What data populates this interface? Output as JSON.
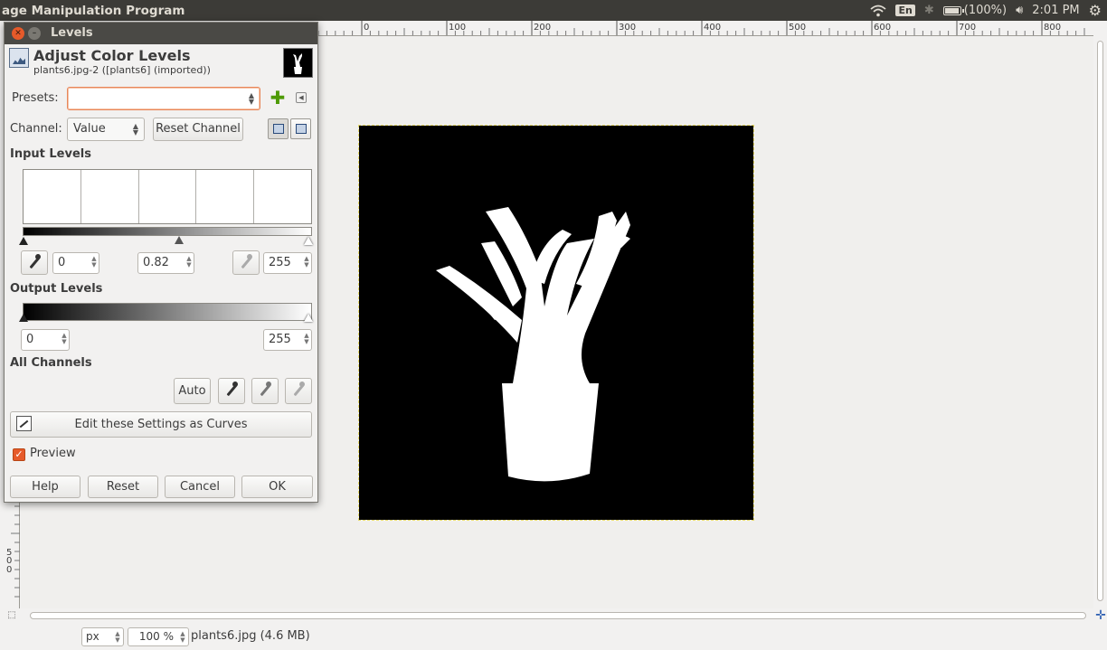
{
  "app": {
    "title": "age Manipulation Program"
  },
  "tray": {
    "keyboard": "En",
    "battery": "(100%)",
    "battery_level": 1.0,
    "time": "2:01 PM"
  },
  "ruler": {
    "h_labels": [
      "0",
      "100",
      "200",
      "300",
      "400",
      "500",
      "600",
      "700",
      "800"
    ],
    "v_labels": [
      "5",
      "0",
      "0"
    ]
  },
  "status": {
    "unit": "px",
    "zoom": "100 %",
    "file": "plants6.jpg (4.6 MB)"
  },
  "dialog": {
    "title": "Levels",
    "heading": "Adjust Color Levels",
    "subheading": "plants6.jpg-2 ([plants6] (imported))",
    "presets_label": "Presets:",
    "presets_value": "",
    "channel_label": "Channel:",
    "channel_value": "Value",
    "reset_channel": "Reset Channel",
    "input_levels": "Input Levels",
    "input_low": "0",
    "input_gamma": "0.82",
    "input_high": "255",
    "output_levels": "Output Levels",
    "output_low": "0",
    "output_high": "255",
    "all_channels": "All Channels",
    "auto": "Auto",
    "edit_curves": "Edit these Settings as Curves",
    "preview": "Preview",
    "preview_checked": true,
    "buttons": {
      "help": "Help",
      "reset": "Reset",
      "cancel": "Cancel",
      "ok": "OK"
    }
  },
  "colors": {
    "accent": "#e65a2a",
    "panel": "#3c3b37",
    "canvas_border": "#e5d96c"
  },
  "icons": [
    "close-icon",
    "minimize-icon",
    "levels-icon",
    "add-preset-icon",
    "preset-menu-icon",
    "linear-histogram-icon",
    "log-histogram-icon",
    "eyedropper-icon",
    "curves-icon",
    "wifi-icon",
    "bluetooth-icon",
    "battery-icon",
    "volume-icon",
    "settings-gear-icon",
    "navigate-icon"
  ]
}
